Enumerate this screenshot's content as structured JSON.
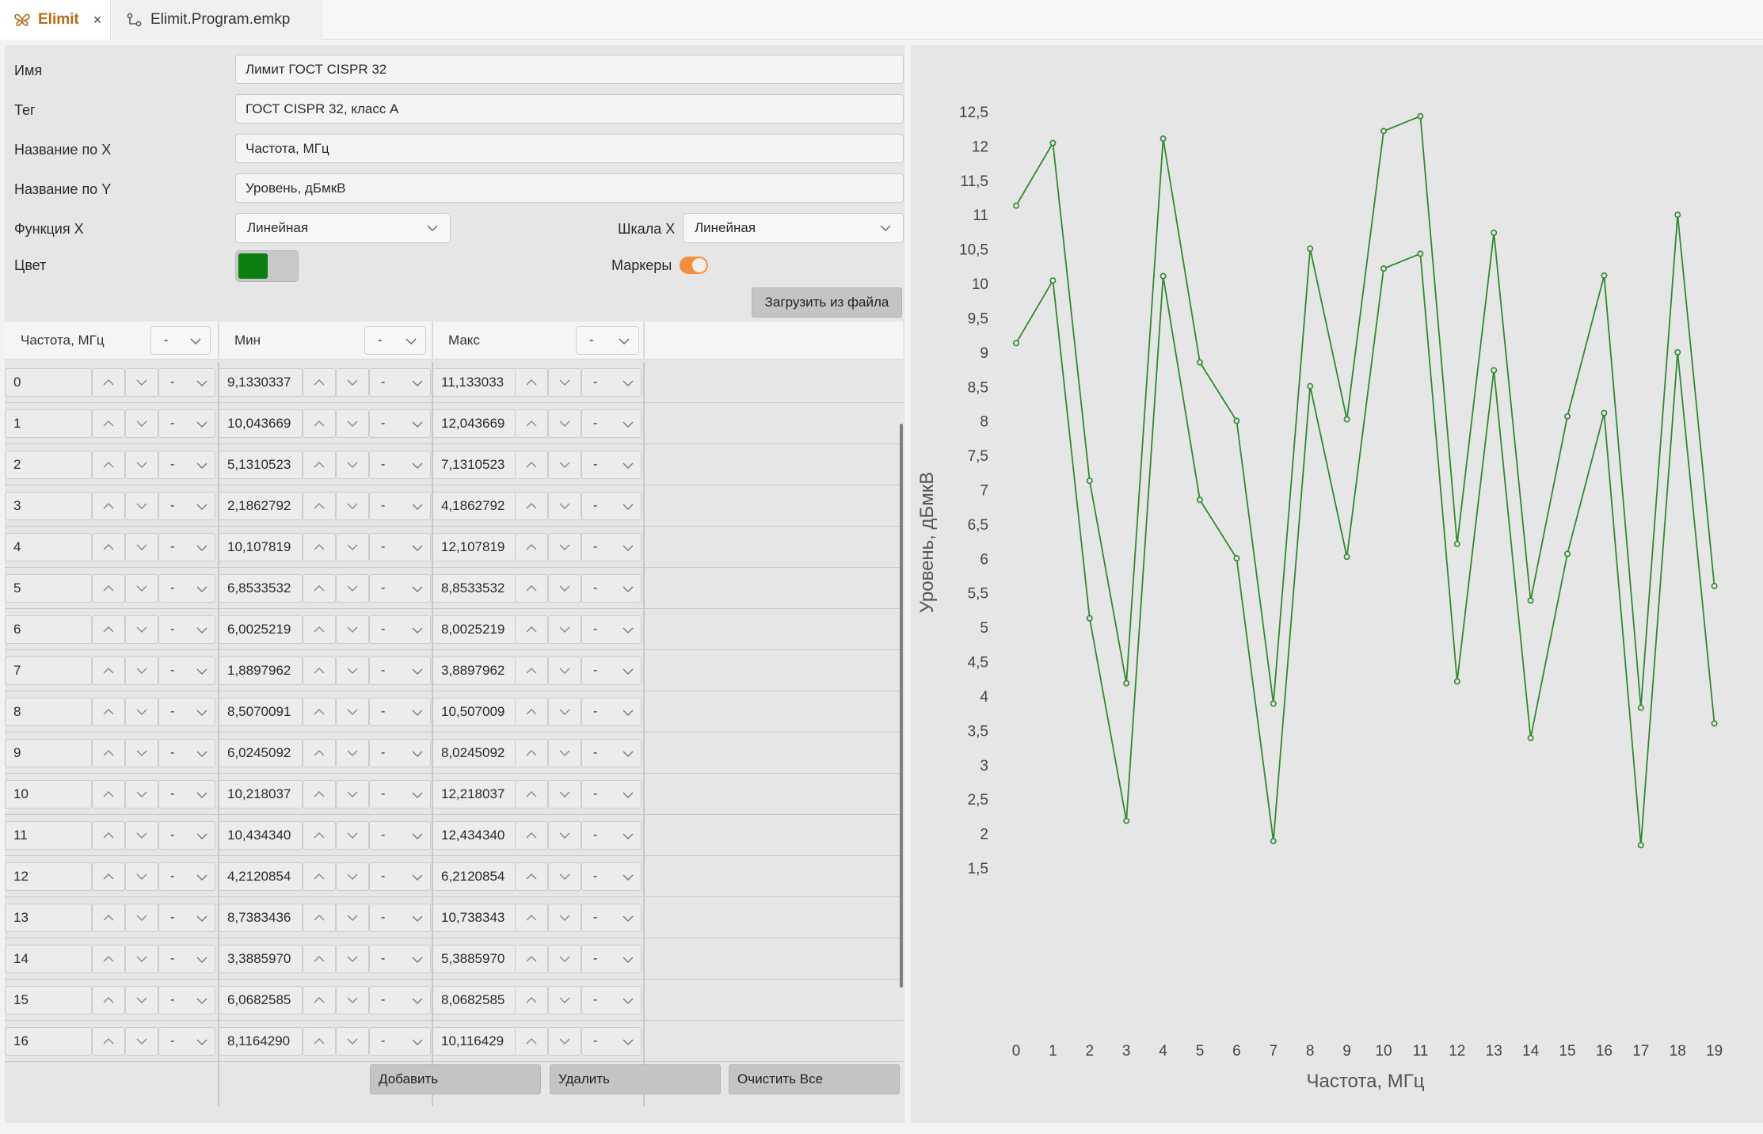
{
  "tabs": [
    {
      "label": "Elimit",
      "icon": "butterfly-icon"
    },
    {
      "label": "Elimit.Program.emkp",
      "icon": "program-icon"
    }
  ],
  "form": {
    "name_label": "Имя",
    "name_value": "Лимит ГОСТ CISPR 32",
    "tag_label": "Тег",
    "tag_value": "ГОСТ CISPR 32, класс А",
    "xname_label": "Название по X",
    "xname_value": "Частота, МГц",
    "yname_label": "Название по Y",
    "yname_value": "Уровень, дБмкВ",
    "func_label": "Функция X",
    "func_value": "Линейная",
    "scale_label": "Шкала X",
    "scale_value": "Линейная",
    "color_label": "Цвет",
    "color_value": "#0a7f10",
    "markers_label": "Маркеры",
    "markers_on": true,
    "load_button": "Загрузить из файла"
  },
  "grid": {
    "headers": [
      {
        "label": "Частота, МГц",
        "select": "-"
      },
      {
        "label": "Мин",
        "select": "-"
      },
      {
        "label": "Макс",
        "select": "-"
      }
    ],
    "rows": [
      [
        "0",
        "9,1330337",
        "11,133033"
      ],
      [
        "1",
        "10,043669",
        "12,043669"
      ],
      [
        "2",
        "5,1310523",
        "7,1310523"
      ],
      [
        "3",
        "2,1862792",
        "4,1862792"
      ],
      [
        "4",
        "10,107819",
        "12,107819"
      ],
      [
        "5",
        "6,8533532",
        "8,8533532"
      ],
      [
        "6",
        "6,0025219",
        "8,0025219"
      ],
      [
        "7",
        "1,8897962",
        "3,8897962"
      ],
      [
        "8",
        "8,5070091",
        "10,507009"
      ],
      [
        "9",
        "6,0245092",
        "8,0245092"
      ],
      [
        "10",
        "10,218037",
        "12,218037"
      ],
      [
        "11",
        "10,434340",
        "12,434340"
      ],
      [
        "12",
        "4,2120854",
        "6,2120854"
      ],
      [
        "13",
        "8,7383436",
        "10,738343"
      ],
      [
        "14",
        "3,3885970",
        "5,3885970"
      ],
      [
        "15",
        "6,0682585",
        "8,0682585"
      ],
      [
        "16",
        "8,1164290",
        "10,116429"
      ]
    ],
    "cell_select": "-"
  },
  "buttons": {
    "add": "Добавить",
    "delete": "Удалить",
    "clear": "Очистить Все"
  },
  "chart_data": {
    "type": "line",
    "xlabel": "Частота, МГц",
    "ylabel": "Уровень, дБмкВ",
    "x": [
      0,
      1,
      2,
      3,
      4,
      5,
      6,
      7,
      8,
      9,
      10,
      11,
      12,
      13,
      14,
      15,
      16,
      17,
      18,
      19
    ],
    "x_ticks": [
      "0",
      "1",
      "2",
      "3",
      "4",
      "5",
      "6",
      "7",
      "8",
      "9",
      "10",
      "11",
      "12",
      "13",
      "14",
      "15",
      "16",
      "17",
      "18",
      "19"
    ],
    "y_ticks": [
      "1,5",
      "2",
      "2,5",
      "3",
      "3,5",
      "4",
      "4,5",
      "5",
      "5,5",
      "6",
      "6,5",
      "7",
      "7,5",
      "8",
      "8,5",
      "9",
      "9,5",
      "10",
      "10,5",
      "11",
      "11,5",
      "12",
      "12,5"
    ],
    "ylim": [
      1.5,
      12.5
    ],
    "series": [
      {
        "values": [
          9.133,
          10.044,
          5.131,
          2.186,
          10.108,
          6.853,
          6.003,
          1.89,
          8.507,
          6.025,
          10.218,
          10.434,
          4.212,
          8.738,
          3.389,
          6.068,
          8.116,
          1.83,
          9.0,
          3.6
        ]
      },
      {
        "values": [
          11.133,
          12.044,
          7.131,
          4.186,
          12.108,
          8.853,
          8.003,
          3.89,
          10.507,
          8.025,
          12.218,
          12.434,
          6.212,
          10.738,
          5.389,
          8.068,
          10.116,
          3.83,
          11.0,
          5.6
        ]
      }
    ],
    "color": "#2e8b2e",
    "markers": true,
    "grid": false,
    "legend": "none"
  }
}
